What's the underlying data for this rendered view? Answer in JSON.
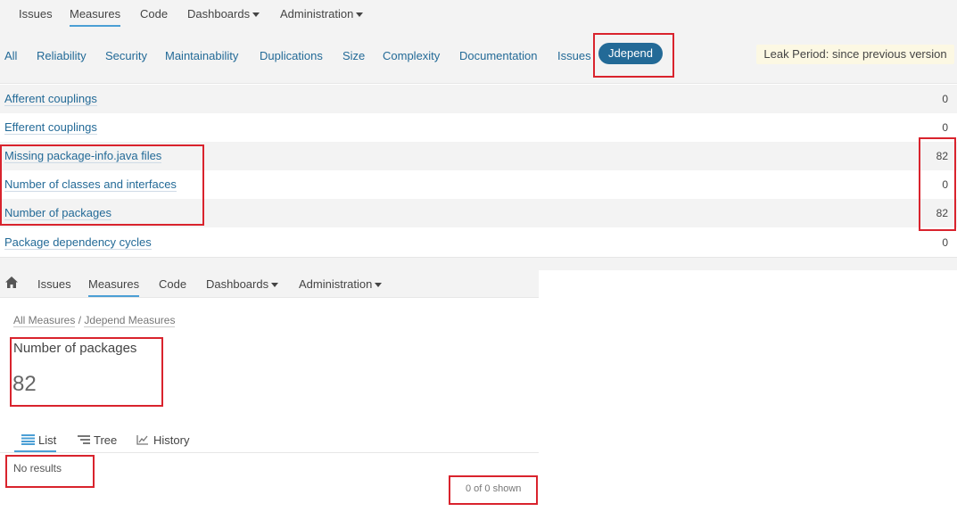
{
  "top_nav": {
    "items": [
      "Issues",
      "Measures",
      "Code",
      "Dashboards",
      "Administration"
    ],
    "active": "Measures"
  },
  "domains": {
    "tabs": [
      "All",
      "Reliability",
      "Security",
      "Maintainability",
      "Duplications",
      "Size",
      "Complexity",
      "Documentation",
      "Issues"
    ],
    "selected": "Jdepend",
    "leak_period": "Leak Period: since previous version"
  },
  "measures": [
    {
      "name": "Afferent couplings",
      "value": "0"
    },
    {
      "name": "Efferent couplings",
      "value": "0"
    },
    {
      "name": "Missing package-info.java files",
      "value": "82"
    },
    {
      "name": "Number of classes and interfaces",
      "value": "0"
    },
    {
      "name": "Number of packages",
      "value": "82"
    },
    {
      "name": "Package dependency cycles",
      "value": "0"
    }
  ],
  "sub_nav": {
    "items": [
      "Issues",
      "Measures",
      "Code",
      "Dashboards",
      "Administration"
    ]
  },
  "breadcrumb": {
    "all": "All Measures",
    "sep": "/",
    "current": "Jdepend Measures"
  },
  "measure_detail": {
    "title": "Number of packages",
    "value": "82"
  },
  "view_tabs": [
    "List",
    "Tree",
    "History"
  ],
  "results": {
    "empty": "No results",
    "count": "0 of 0 shown"
  },
  "colors": {
    "accent": "#236a97",
    "highlight_box": "#d9232d",
    "leak_bg": "#fcf8e3"
  }
}
